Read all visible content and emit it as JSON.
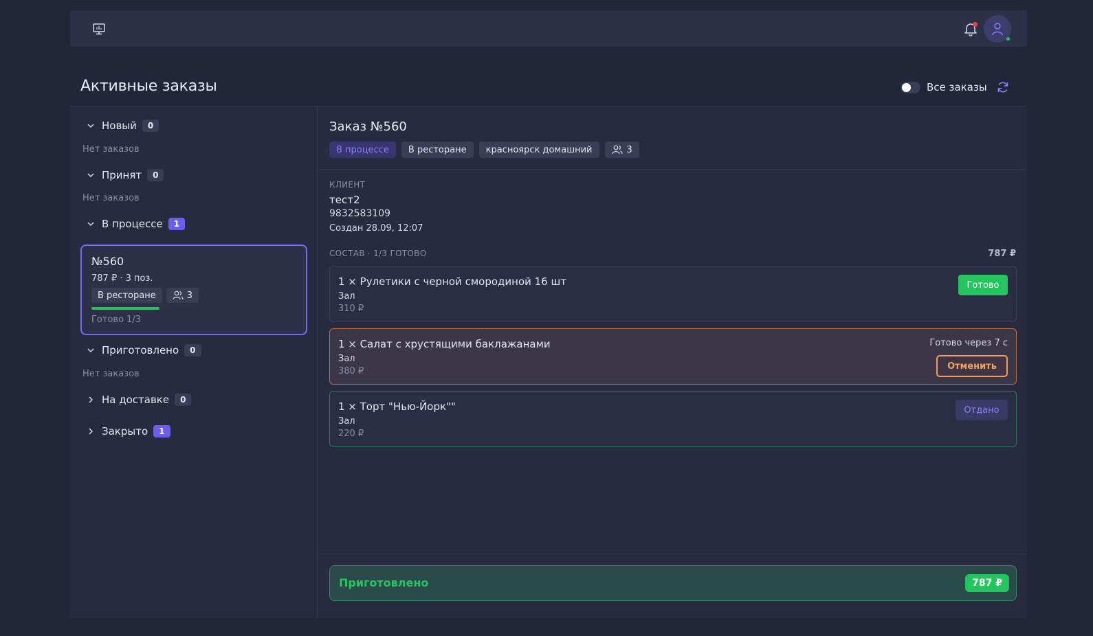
{
  "page": {
    "title": "Активные заказы",
    "toggle_label": "Все заказы"
  },
  "header": {
    "left_icon": "monitor-icon",
    "bell_icon": "bell-icon",
    "avatar_icon": "user-icon"
  },
  "sections": [
    {
      "label": "Новый",
      "count": "0",
      "expanded": true,
      "empty_text": "Нет заказов"
    },
    {
      "label": "Принят",
      "count": "0",
      "expanded": true,
      "empty_text": "Нет заказов"
    },
    {
      "label": "В процессе",
      "count": "1",
      "expanded": true
    },
    {
      "label": "Приготовлено",
      "count": "0",
      "expanded": true,
      "empty_text": "Нет заказов"
    },
    {
      "label": "На доставке",
      "count": "0",
      "expanded": false
    },
    {
      "label": "Закрыто",
      "count": "1",
      "expanded": false
    }
  ],
  "order_card": {
    "number": "№560",
    "meta": "787 ₽ · 3 поз.",
    "tag_place": "В ресторане",
    "guests": "3",
    "progress": 0.33,
    "status": "Готово 1/3"
  },
  "detail": {
    "title": "Заказ №560",
    "tags": {
      "status": "В процессе",
      "place": "В ресторане",
      "restaurant": "красноярск домашний",
      "guests": "3"
    },
    "client_label": "КЛИЕНТ",
    "client_name": "тест2",
    "client_phone": "9832583109",
    "created": "Создан 28.09, 12:07",
    "sostav_label": "СОСТАВ · 1/3 ГОТОВО",
    "sostav_total": "787 ₽",
    "items": [
      {
        "name": "1 × Рулетики с черной смородиной 16 шт",
        "place": "Зал",
        "price": "310 ₽",
        "action": "Готово"
      },
      {
        "name": "1 × Салат с хрустящими баклажанами",
        "place": "Зал",
        "price": "380 ₽",
        "timer": "Готово через 7 с",
        "action": "Отменить"
      },
      {
        "name": "1 × Торт \"Нью-Йорк\"\"",
        "place": "Зал",
        "price": "220 ₽",
        "action": "Отдано"
      }
    ],
    "footer_label": "Приготовлено",
    "footer_total": "787 ₽"
  },
  "colors": {
    "accent": "#6d5cf0",
    "success": "#22c55e",
    "warning": "#f0a052"
  }
}
